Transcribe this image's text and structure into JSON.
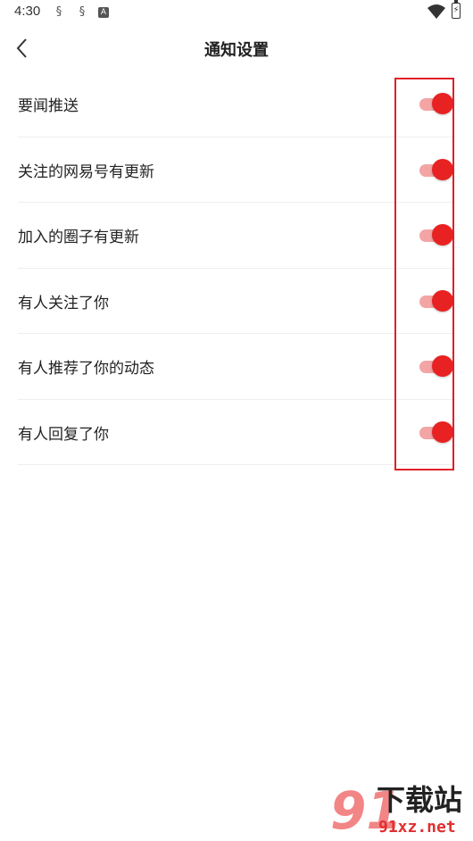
{
  "status_bar": {
    "time": "4:30",
    "icons": [
      "notification-app-icon",
      "notification-app-icon",
      "notification-a-icon",
      "wifi-icon",
      "battery-charging-icon"
    ]
  },
  "header": {
    "title": "通知设置",
    "back_icon": "chevron-left-icon"
  },
  "settings": [
    {
      "label": "要闻推送",
      "enabled": true
    },
    {
      "label": "关注的网易号有更新",
      "enabled": true
    },
    {
      "label": "加入的圈子有更新",
      "enabled": true
    },
    {
      "label": "有人关注了你",
      "enabled": true
    },
    {
      "label": "有人推荐了你的动态",
      "enabled": true
    },
    {
      "label": "有人回复了你",
      "enabled": true
    }
  ],
  "colors": {
    "accent": "#e82222",
    "track_on": "#f3a4a4",
    "highlight": "#e0202a"
  },
  "watermark": {
    "number": "91",
    "title": "下载站",
    "url": "91xz.net"
  }
}
